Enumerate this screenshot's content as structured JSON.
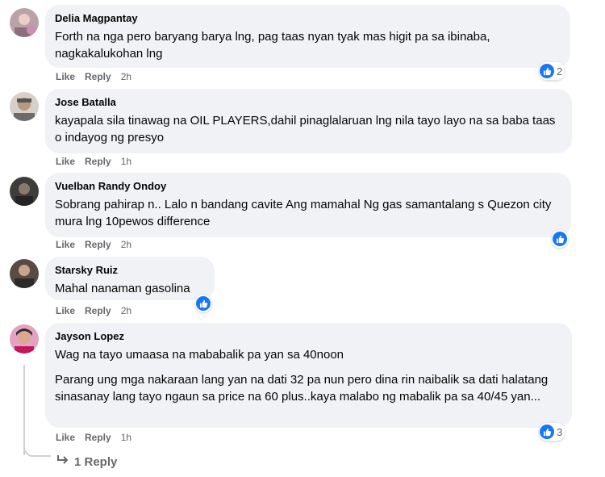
{
  "comments": [
    {
      "author": "Delia Magpantay",
      "lines": [
        "Forth na nga pero baryang barya lng, pag taas nyan tyak mas higit pa sa ibinaba, nagkakalukohan lng"
      ],
      "actions": {
        "like": "Like",
        "reply": "Reply",
        "time": "2h"
      },
      "reaction_count": "2"
    },
    {
      "author": "Jose Batalla",
      "lines": [
        "kayapala sila tinawag na OIL PLAYERS,dahil pinaglalaruan lng nila tayo layo na sa baba taas o indayog ng presyo"
      ],
      "actions": {
        "like": "Like",
        "reply": "Reply",
        "time": "1h"
      }
    },
    {
      "author": "Vuelban Randy Ondoy",
      "lines": [
        "Sobrang pahirap n.. Lalo n bandang cavite Ang mamahal Ng gas samantalang s Quezon city mura lng 10pewos difference"
      ],
      "actions": {
        "like": "Like",
        "reply": "Reply",
        "time": "2h"
      }
    },
    {
      "author": "Starsky Ruiz",
      "lines": [
        "Mahal nanaman gasolina"
      ],
      "actions": {
        "like": "Like",
        "reply": "Reply",
        "time": "2h"
      }
    },
    {
      "author": "Jayson Lopez",
      "lines": [
        "Wag na tayo umaasa na mababalik pa yan sa 40noon",
        "Parang ung mga nakaraan lang yan na dati 32 pa nun pero dina rin naibalik sa dati halatang sinasanay lang tayo ngaun sa price na 60 plus..kaya malabo ng mabalik pa sa 40/45 yan..."
      ],
      "actions": {
        "like": "Like",
        "reply": "Reply",
        "time": "1h"
      },
      "reaction_count": "3"
    }
  ],
  "replies_link": "1 Reply",
  "colors": {
    "bubble": "#f0f2f5",
    "like_blue": "#1877f2",
    "meta": "#65676b"
  }
}
